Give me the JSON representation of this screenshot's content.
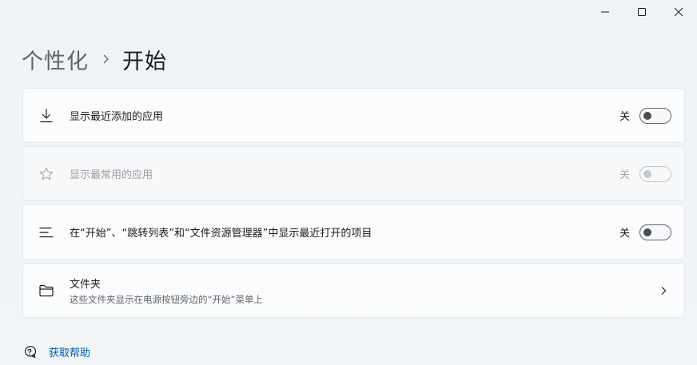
{
  "caption": {
    "minimize_icon": "minimize-icon",
    "maximize_icon": "maximize-icon",
    "close_icon": "close-icon"
  },
  "breadcrumb": {
    "parent": "个性化",
    "current": "开始"
  },
  "settings": [
    {
      "icon": "download-icon",
      "title": "显示最近添加的应用",
      "state": "关",
      "enabled": true
    },
    {
      "icon": "star-icon",
      "title": "显示最常用的应用",
      "state": "关",
      "enabled": false
    },
    {
      "icon": "list-icon",
      "title": "在“开始”、“跳转列表”和“文件资源管理器”中显示最近打开的项目",
      "state": "关",
      "enabled": true
    },
    {
      "icon": "folder-icon",
      "title": "文件夹",
      "subtitle": "这些文件夹显示在电源按钮旁边的“开始”菜单上"
    }
  ],
  "help": {
    "label": "获取帮助",
    "icon": "help-chat-icon"
  },
  "colors": {
    "accent_link": "#0b57a4",
    "background": "#f0f4f9",
    "card": "#fbfcfd"
  }
}
